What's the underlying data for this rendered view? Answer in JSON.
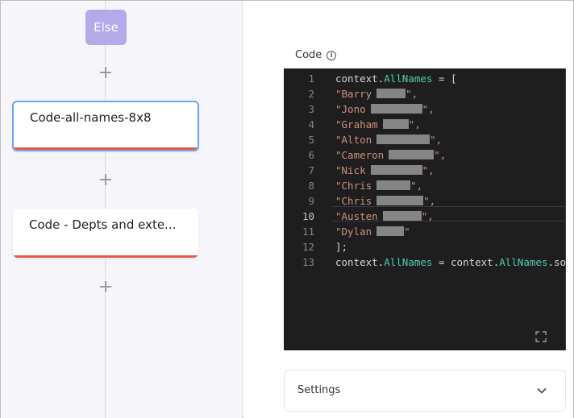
{
  "flow": {
    "else_label": "Else",
    "nodes": [
      {
        "title": "Code-all-names-8x8",
        "selected": true
      },
      {
        "title": "Code - Depts and exte...",
        "selected": false
      }
    ]
  },
  "panel": {
    "code_label": "Code",
    "settings_label": "Settings"
  },
  "editor": {
    "lines": [
      {
        "n": "1",
        "pre": "context.",
        "prop": "AllNames",
        "post": " = ["
      },
      {
        "n": "2",
        "str": "\"Barry",
        "redact": 36,
        "tail": "\","
      },
      {
        "n": "3",
        "str": "\"Jono",
        "redact": 64,
        "tail": "\","
      },
      {
        "n": "4",
        "str": "\"Graham",
        "redact": 32,
        "tail": "\","
      },
      {
        "n": "5",
        "str": "\"Alton",
        "redact": 66,
        "tail": "\","
      },
      {
        "n": "6",
        "str": "\"Cameron",
        "redact": 56,
        "tail": "\","
      },
      {
        "n": "7",
        "str": "\"Nick",
        "redact": 64,
        "tail": "\","
      },
      {
        "n": "8",
        "str": "\"Chris",
        "redact": 42,
        "tail": "\","
      },
      {
        "n": "9",
        "str": "\"Chris",
        "redact": 58,
        "tail": "\","
      },
      {
        "n": "10",
        "str": "\"Austen",
        "redact": 48,
        "tail": "\","
      },
      {
        "n": "11",
        "str": "\"Dylan",
        "redact": 34,
        "tail": "\""
      },
      {
        "n": "12",
        "plain": "];"
      },
      {
        "n": "13",
        "pre": "context.",
        "prop": "AllNames",
        "post": " = context.",
        "prop2": "AllNames",
        "post2": ".so"
      }
    ],
    "active_line": 10
  }
}
